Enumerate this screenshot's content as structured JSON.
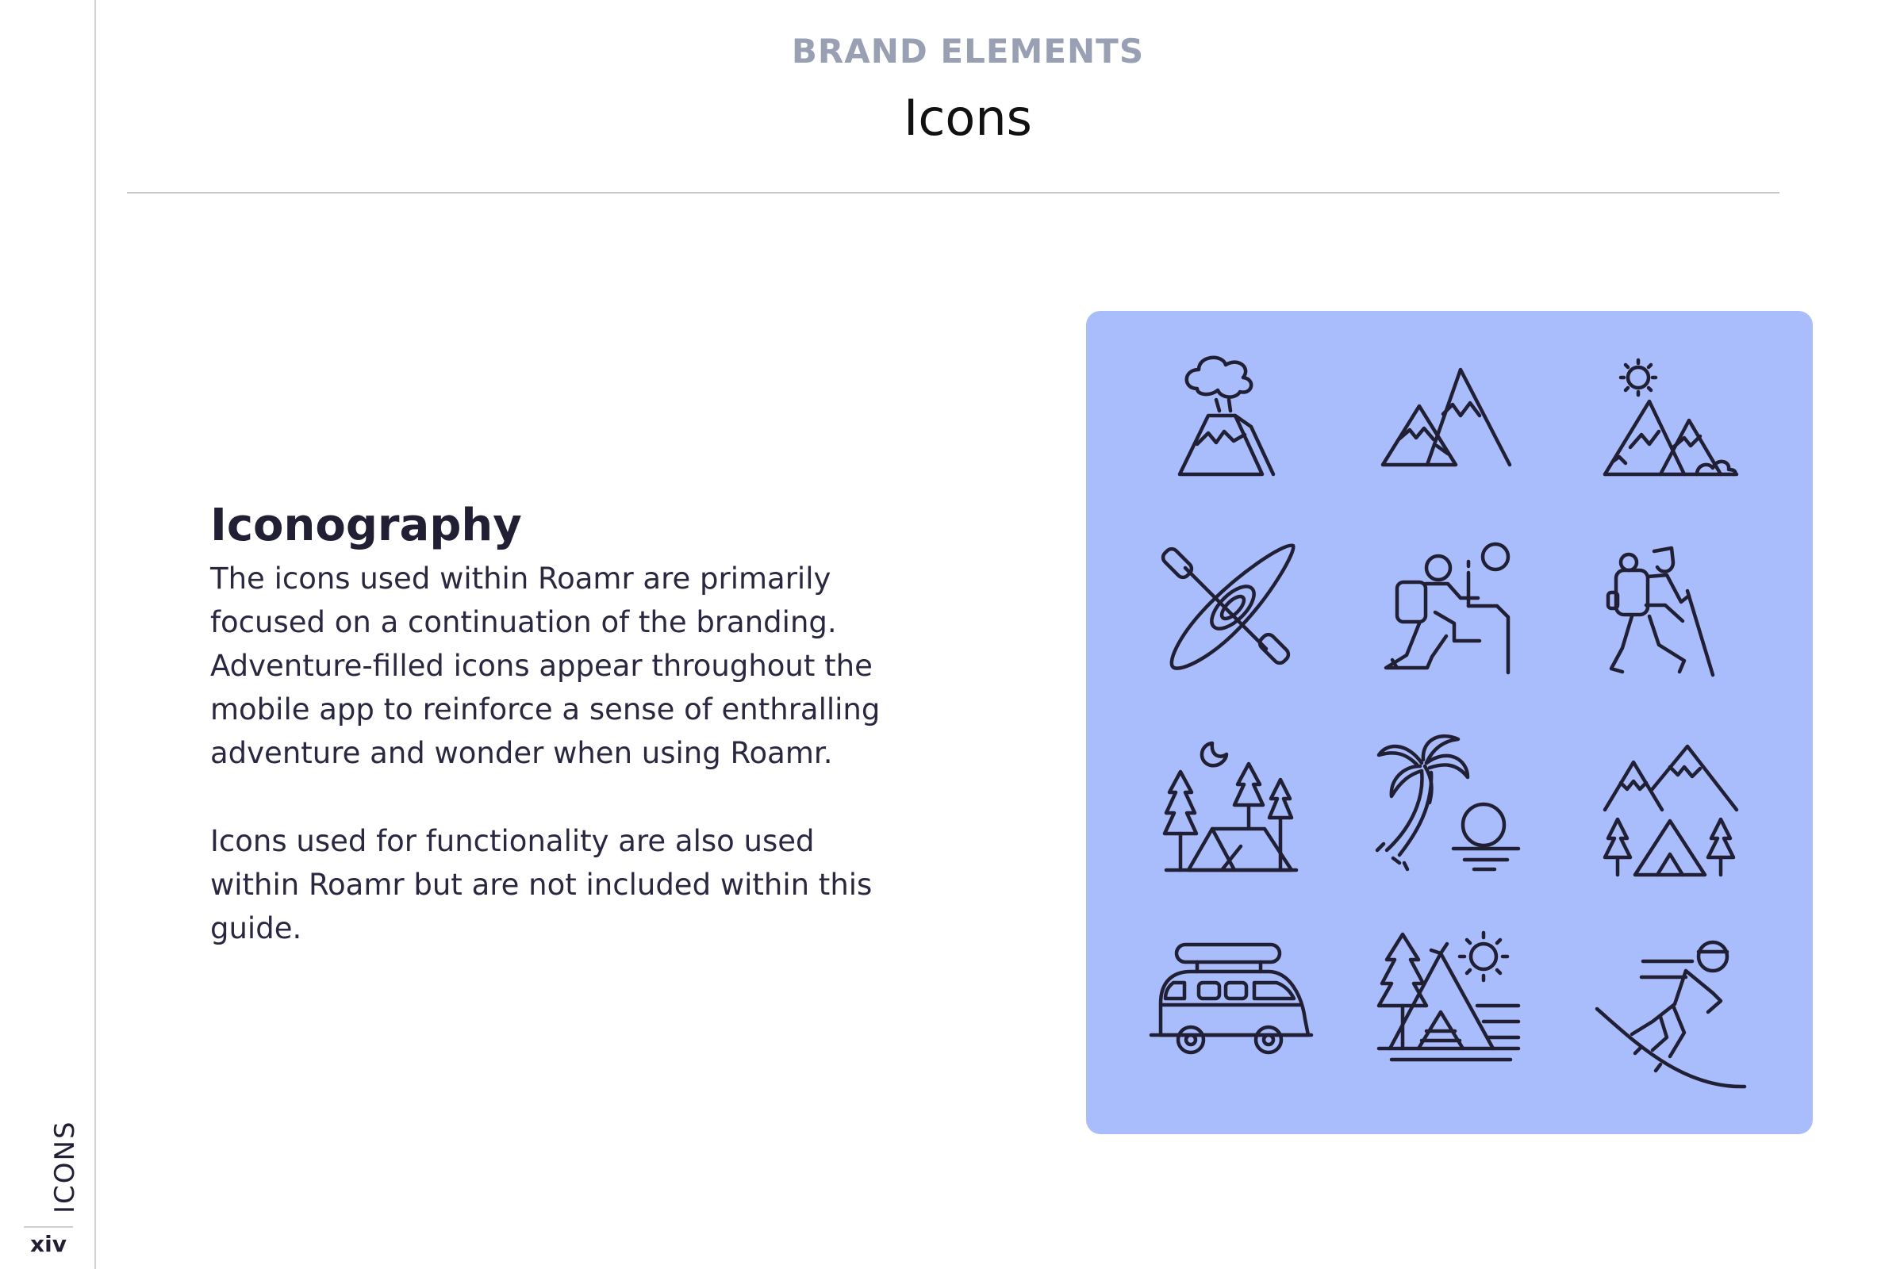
{
  "header": {
    "kicker": "BRAND ELEMENTS",
    "title": "Icons"
  },
  "sidebar": {
    "section_label": "ICONS",
    "page_number": "xiv"
  },
  "content": {
    "heading": "Iconography",
    "paragraphs": [
      "The icons used within Roamr are primarily focused on a continuation of the branding. Adventure-filled icons appear throughout the mobile app to reinforce a sense of enthralling adventure and wonder when using Roamr.",
      "Icons used for functionality are also used within Roamr but are not included within this guide."
    ]
  },
  "icon_grid": {
    "background": "#a9bcfc",
    "stroke_color": "#211f33",
    "icons": [
      "volcano-icon",
      "mountains-icon",
      "mountains-sun-icon",
      "kayak-icon",
      "climber-icon",
      "hiker-icon",
      "forest-tent-moon-icon",
      "palm-beach-sunset-icon",
      "mountains-camp-icon",
      "camper-van-icon",
      "teepee-sun-icon",
      "skier-icon"
    ]
  }
}
